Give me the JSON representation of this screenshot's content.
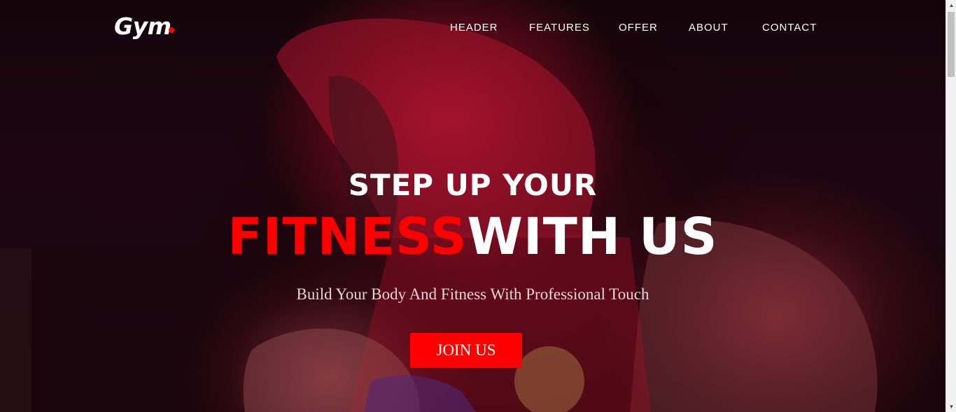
{
  "brand": {
    "logo_text": "Gym",
    "dot_color": "#ff0000"
  },
  "nav": {
    "items": [
      {
        "label": "HEADER"
      },
      {
        "label": "FEATURES"
      },
      {
        "label": "OFFER"
      },
      {
        "label": "ABOUT"
      },
      {
        "label": "CONTACT"
      }
    ]
  },
  "hero": {
    "headline_line1": "STEP UP YOUR",
    "headline_accent": "FITNESS",
    "headline_rest": "WITH US",
    "tagline": "Build Your Body And Fitness With Professional Touch",
    "cta_label": "JOIN US",
    "background_subject": "boxer-in-red-hoodie-photo"
  },
  "colors": {
    "accent": "#ff0000",
    "text": "#ffffff",
    "background": "#1a050c"
  },
  "scrollbar": {
    "up_icon": "arrow-up-icon",
    "down_icon": "arrow-down-icon"
  }
}
